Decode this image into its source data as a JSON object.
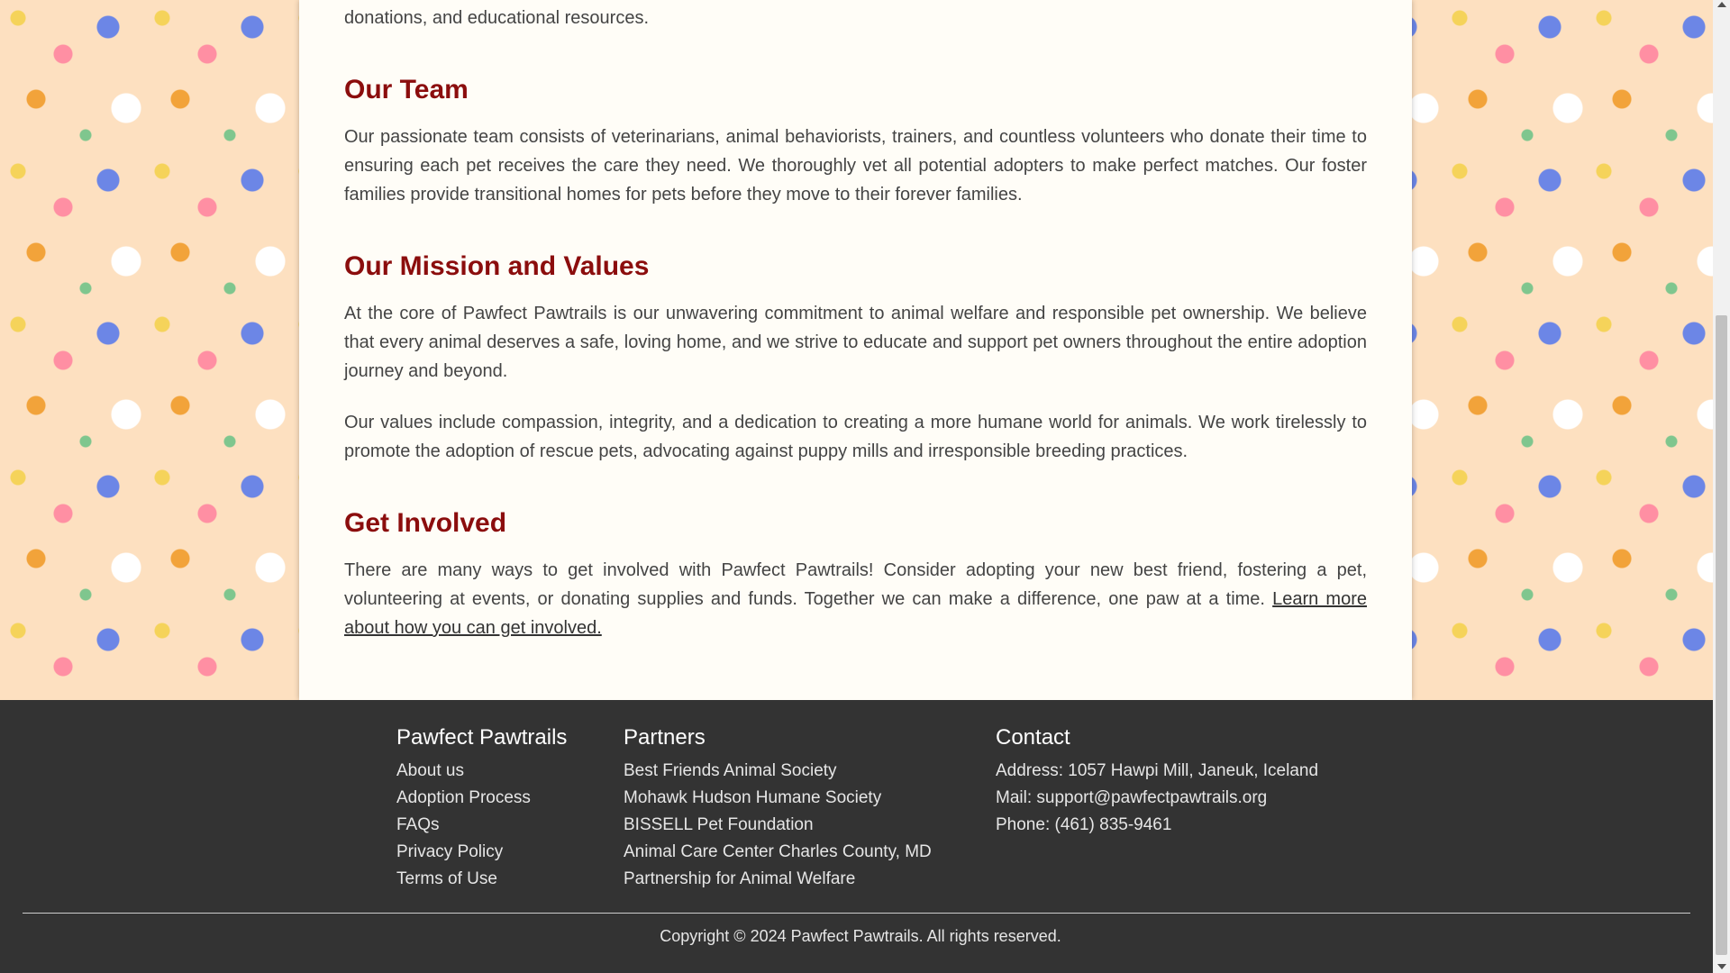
{
  "content": {
    "lead_text": "donations, and educational resources.",
    "sections": [
      {
        "heading": "Our Team",
        "paragraphs": [
          "Our passionate team consists of veterinarians, animal behaviorists, trainers, and countless volunteers who donate their time to ensuring each pet receives the care they need. We thoroughly vet all potential adopters to make perfect matches. Our foster families provide transitional homes for pets before they move to their forever families."
        ]
      },
      {
        "heading": "Our Mission and Values",
        "paragraphs": [
          "At the core of Pawfect Pawtrails is our unwavering commitment to animal welfare and responsible pet ownership. We believe that every animal deserves a safe, loving home, and we strive to educate and support pet owners throughout the entire adoption journey and beyond.",
          "Our values include compassion, integrity, and a dedication to creating a more humane world for animals. We work tirelessly to promote the adoption of rescue pets, advocating against puppy mills and irresponsible breeding practices."
        ]
      },
      {
        "heading": "Get Involved",
        "text": "There are many ways to get involved with Pawfect Pawtrails! Consider adopting your new best friend, fostering a pet, volunteering at events, or donating supplies and funds. Together we can make a difference, one paw at a time. ",
        "link_text": "Learn more about how you can get involved."
      }
    ]
  },
  "footer": {
    "brand": {
      "title": "Pawfect Pawtrails",
      "links": [
        "About us",
        "Adoption Process",
        "FAQs",
        "Privacy Policy",
        "Terms of Use"
      ]
    },
    "partners": {
      "title": "Partners",
      "links": [
        "Best Friends Animal Society",
        "Mohawk Hudson Humane Society",
        "BISSELL Pet Foundation",
        "Animal Care Center Charles County, MD",
        "Partnership for Animal Welfare"
      ]
    },
    "contact": {
      "title": "Contact",
      "lines": [
        "Address: 1057 Hawpi Mill, Janeuk, Iceland",
        "Mail: support@pawfectpawtrails.org",
        "Phone: (461) 835-9461"
      ]
    },
    "copyright": "Copyright © 2024 Pawfect Pawtrails. All rights reserved."
  },
  "colors": {
    "heading": "#8b0d0d",
    "footer_bg": "#333333",
    "card_bg": "#fffdf7",
    "pattern_bg": "#fde0c0"
  },
  "icons": [
    "scroll-up-arrow-icon",
    "scroll-down-arrow-icon"
  ]
}
